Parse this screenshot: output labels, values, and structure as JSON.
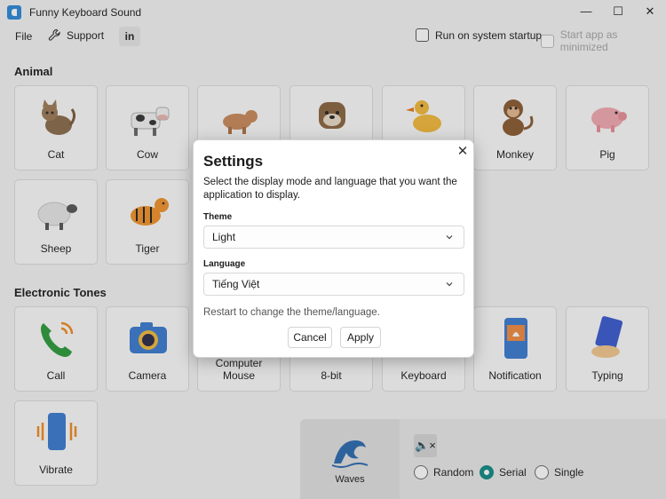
{
  "window": {
    "title": "Funny Keyboard Sound",
    "minimize": "—",
    "maximize": "☐",
    "close": "✕"
  },
  "menu": {
    "file": "File",
    "support": "Support",
    "linkedin": "in"
  },
  "options": {
    "startup": "Run on system startup",
    "minimized": "Start app as minimized"
  },
  "sections": {
    "animal": "Animal",
    "electronic": "Electronic Tones"
  },
  "animals": [
    "Cat",
    "Cow",
    "",
    "",
    "",
    "Monkey",
    "Pig",
    "Sheep",
    "Tiger"
  ],
  "electronic": [
    "Call",
    "Camera",
    "Computer Mouse",
    "8-bit",
    "Keyboard",
    "Notification",
    "Typing",
    "Vibrate"
  ],
  "player": {
    "current": "Waves",
    "mute_icon": "🔈×",
    "modes": [
      "Random",
      "Serial",
      "Single"
    ],
    "selected_mode": "Serial"
  },
  "dialog": {
    "title": "Settings",
    "close": "✕",
    "description": "Select the display mode and language that you want the application to display.",
    "theme_label": "Theme",
    "theme_value": "Light",
    "language_label": "Language",
    "language_value": "Tiếng Việt",
    "note": "Restart to change the theme/language.",
    "cancel": "Cancel",
    "apply": "Apply"
  },
  "colors": {
    "accent": "#0f8a84",
    "app_icon": "#2b88d8"
  },
  "icons": [
    "app-icon",
    "wrench-icon",
    "linkedin-icon",
    "chevron-down-icon",
    "close-icon",
    "speaker-mute-icon",
    "waves-icon"
  ]
}
